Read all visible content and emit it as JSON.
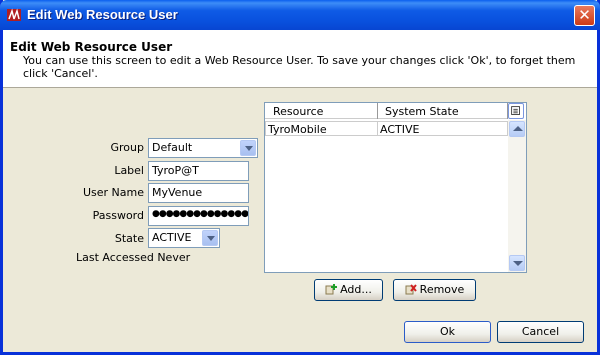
{
  "window": {
    "title": "Edit Web Resource User"
  },
  "header": {
    "title": "Edit Web Resource User",
    "description": "You can use this screen to edit a Web Resource User. To save your changes click 'Ok', to forget them click 'Cancel'."
  },
  "form": {
    "group": {
      "label": "Group",
      "value": "Default"
    },
    "label": {
      "label": "Label",
      "value": "TyroP@T"
    },
    "username": {
      "label": "User Name",
      "value": "MyVenue"
    },
    "password": {
      "label": "Password",
      "value": "●●●●●●●●●●●●●●"
    },
    "state": {
      "label": "State",
      "value": "ACTIVE"
    },
    "last_accessed": {
      "label": "Last Accessed",
      "value": "Never"
    }
  },
  "table": {
    "columns": [
      "Resource",
      "System State"
    ],
    "rows": [
      [
        "TyroMobile",
        "ACTIVE"
      ]
    ]
  },
  "buttons": {
    "add": "Add...",
    "remove": "Remove",
    "ok": "Ok",
    "cancel": "Cancel"
  },
  "colors": {
    "titlebar": "#0A5FEF",
    "face": "#ECE9D8",
    "border": "#7F9DB9"
  },
  "icons": [
    "app-icon",
    "close-icon",
    "add-icon",
    "remove-icon",
    "column-chooser-icon"
  ]
}
